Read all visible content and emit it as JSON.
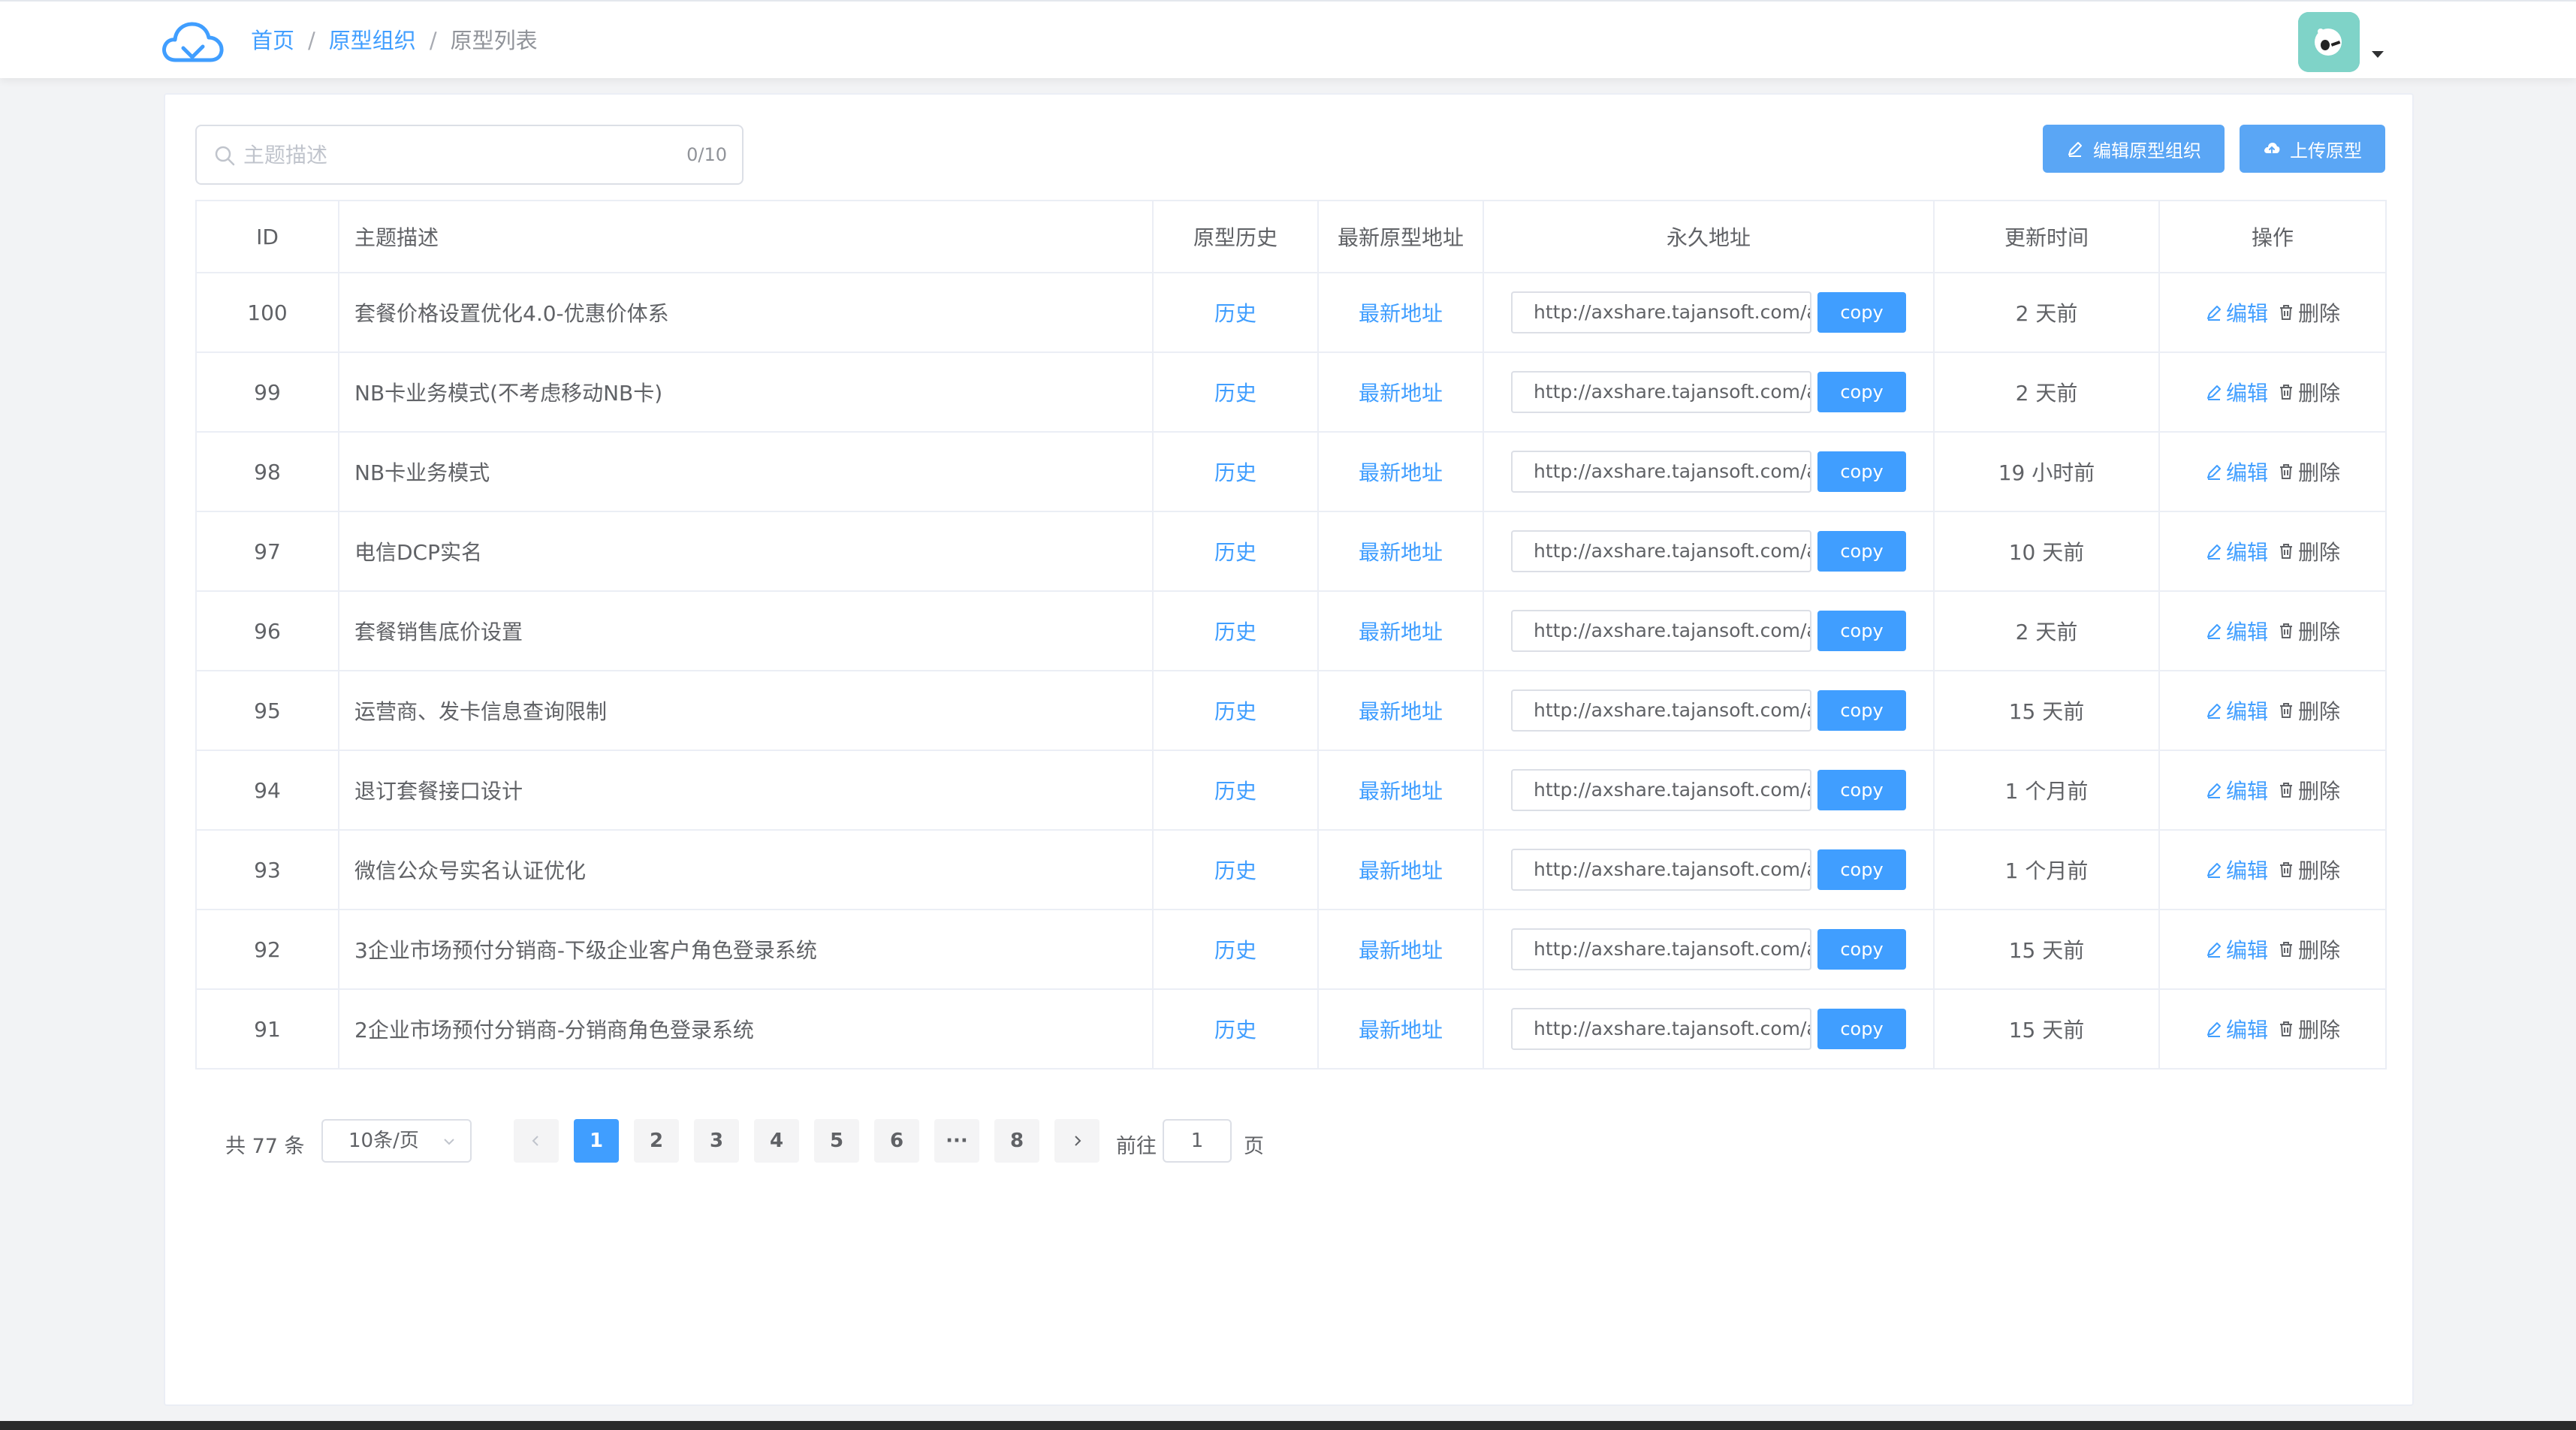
{
  "breadcrumb": {
    "home": "首页",
    "group": "原型组织",
    "current": "原型列表",
    "separator": "/"
  },
  "search": {
    "placeholder": "主题描述",
    "value": "",
    "count": "0/10"
  },
  "toolbar": {
    "edit_org_label": "编辑原型组织",
    "upload_label": "上传原型"
  },
  "table": {
    "headers": [
      "ID",
      "主题描述",
      "原型历史",
      "最新原型地址",
      "永久地址",
      "更新时间",
      "操作"
    ],
    "history_label": "历史",
    "latest_label": "最新地址",
    "copy_label": "copy",
    "edit_label": "编辑",
    "delete_label": "删除",
    "rows": [
      {
        "id": "100",
        "topic": "套餐价格设置优化4.0-优惠价体系",
        "url": "http://axshare.tajansoft.com/axure",
        "updated": "2 天前"
      },
      {
        "id": "99",
        "topic": "NB卡业务模式(不考虑移动NB卡)",
        "url": "http://axshare.tajansoft.com/axure",
        "updated": "2 天前"
      },
      {
        "id": "98",
        "topic": "NB卡业务模式",
        "url": "http://axshare.tajansoft.com/axure",
        "updated": "19 小时前"
      },
      {
        "id": "97",
        "topic": "电信DCP实名",
        "url": "http://axshare.tajansoft.com/axure",
        "updated": "10 天前"
      },
      {
        "id": "96",
        "topic": "套餐销售底价设置",
        "url": "http://axshare.tajansoft.com/axure",
        "updated": "2 天前"
      },
      {
        "id": "95",
        "topic": "运营商、发卡信息查询限制",
        "url": "http://axshare.tajansoft.com/axure",
        "updated": "15 天前"
      },
      {
        "id": "94",
        "topic": "退订套餐接口设计",
        "url": "http://axshare.tajansoft.com/axure",
        "updated": "1 个月前"
      },
      {
        "id": "93",
        "topic": "微信公众号实名认证优化",
        "url": "http://axshare.tajansoft.com/axure",
        "updated": "1 个月前"
      },
      {
        "id": "92",
        "topic": "3企业市场预付分销商-下级企业客户角色登录系统",
        "url": "http://axshare.tajansoft.com/axure",
        "updated": "15 天前"
      },
      {
        "id": "91",
        "topic": "2企业市场预付分销商-分销商角色登录系统",
        "url": "http://axshare.tajansoft.com/axure",
        "updated": "15 天前"
      }
    ]
  },
  "pagination": {
    "total": "共 77 条",
    "page_size": "10条/页",
    "pages": [
      "1",
      "2",
      "3",
      "4",
      "5",
      "6",
      "···",
      "8"
    ],
    "current_page": "1",
    "goto_label": "前往",
    "goto_value": "1",
    "goto_suffix": "页"
  },
  "colors": {
    "primary": "#409eff",
    "button": "#5aa6f5",
    "avatar": "#7fd3c8"
  }
}
